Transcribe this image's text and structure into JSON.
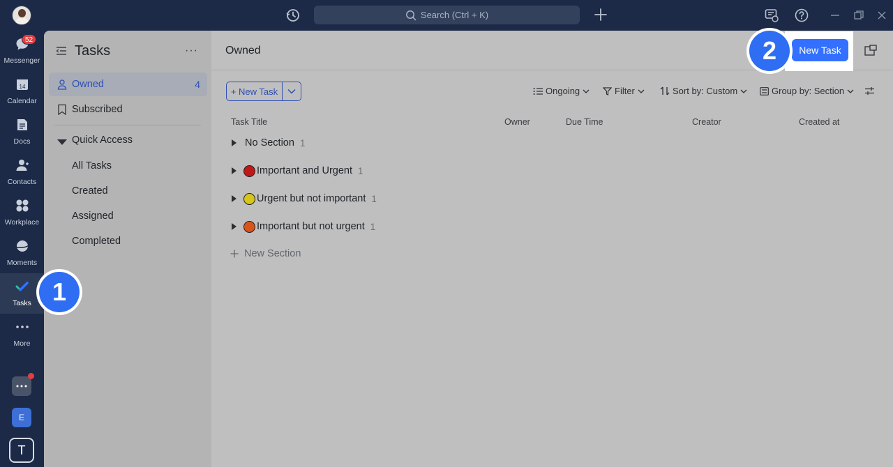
{
  "topbar": {
    "search_placeholder": "Search (Ctrl + K)"
  },
  "rail": {
    "items": [
      {
        "label": "Messenger",
        "badge": "52"
      },
      {
        "label": "Calendar",
        "day": "14"
      },
      {
        "label": "Docs"
      },
      {
        "label": "Contacts"
      },
      {
        "label": "Workplace"
      },
      {
        "label": "Moments"
      },
      {
        "label": "Tasks"
      },
      {
        "label": "More"
      }
    ],
    "apps": [
      {
        "letter": "E"
      },
      {
        "letter": "T"
      }
    ]
  },
  "sidebar": {
    "title": "Tasks",
    "more": "···",
    "owned": {
      "label": "Owned",
      "count": "4"
    },
    "subscribed": "Subscribed",
    "quick_access": "Quick Access",
    "sub_items": [
      "All Tasks",
      "Created",
      "Assigned",
      "Completed"
    ]
  },
  "main": {
    "title": "Owned",
    "new_task_top": "New Task",
    "new_task_btn": "+ New Task",
    "toolbar": {
      "ongoing": "Ongoing",
      "filter": "Filter",
      "sort": "Sort by: Custom",
      "group": "Group by: Section"
    },
    "columns": [
      "Task Title",
      "Owner",
      "Due Time",
      "Creator",
      "Created at"
    ],
    "sections": [
      {
        "name": "No Section",
        "count": "1",
        "color": ""
      },
      {
        "name": "Important and Urgent",
        "count": "1",
        "color": "#c01818"
      },
      {
        "name": "Urgent but not important",
        "count": "1",
        "color": "#d6c51a"
      },
      {
        "name": "Important but not urgent",
        "count": "1",
        "color": "#d8541a"
      }
    ],
    "new_section": "New Section"
  },
  "steps": [
    "1",
    "2"
  ],
  "colors": {
    "accent": "#3370ff",
    "rail_bg": "#1c2a47"
  }
}
